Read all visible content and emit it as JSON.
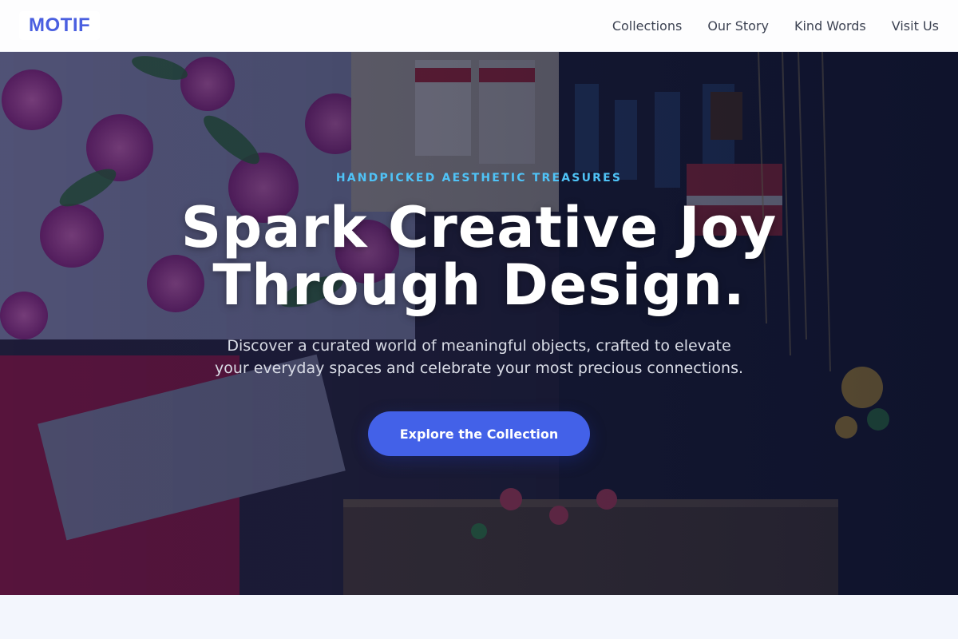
{
  "brand": {
    "logo": "MOTIF",
    "accent_color": "#4a5fe0"
  },
  "nav": {
    "links": [
      "Collections",
      "Our Story",
      "Kind Words",
      "Visit Us"
    ]
  },
  "hero": {
    "eyebrow": "HANDPICKED AESTHETIC TREASURES",
    "headline_line1": "Spark Creative Joy",
    "headline_line2": "Through Design.",
    "subtitle": "Discover a curated world of meaningful objects, crafted to elevate your everyday spaces and celebrate your most precious connections.",
    "cta_label": "Explore the Collection",
    "background_image": "market-stall-photo",
    "eyebrow_color": "#4fc3f7",
    "cta_color": "#4361e8"
  }
}
